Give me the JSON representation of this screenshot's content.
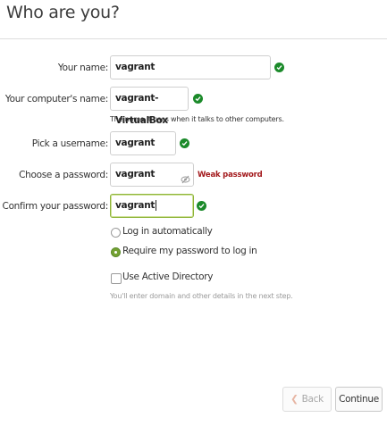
{
  "page": {
    "title": "Who are you?"
  },
  "form": {
    "name": {
      "label": "Your name:",
      "value": "vagrant"
    },
    "computer": {
      "label": "Your computer's name:",
      "value": "vagrant-VirtualBox",
      "hint": "The name it uses when it talks to other computers."
    },
    "username": {
      "label": "Pick a username:",
      "value": "vagrant"
    },
    "password": {
      "label": "Choose a password:",
      "value": "vagrant",
      "strength": "Weak password"
    },
    "confirm": {
      "label": "Confirm your password:",
      "value": "vagrant"
    },
    "login_options": [
      {
        "label": "Log in automatically",
        "selected": false
      },
      {
        "label": "Require my password to log in",
        "selected": true
      }
    ],
    "active_directory": {
      "label": "Use Active Directory",
      "checked": false,
      "hint": "You'll enter domain and other details in the next step."
    }
  },
  "buttons": {
    "back": "Back",
    "continue": "Continue"
  },
  "colors": {
    "valid_check": "#1b8a2a",
    "weak_password": "#a3191c",
    "radio_selected": "#74a132"
  },
  "icons": {
    "valid": "check-circle-icon",
    "reveal_password": "eye-slash-icon",
    "back": "chevron-left-icon"
  }
}
